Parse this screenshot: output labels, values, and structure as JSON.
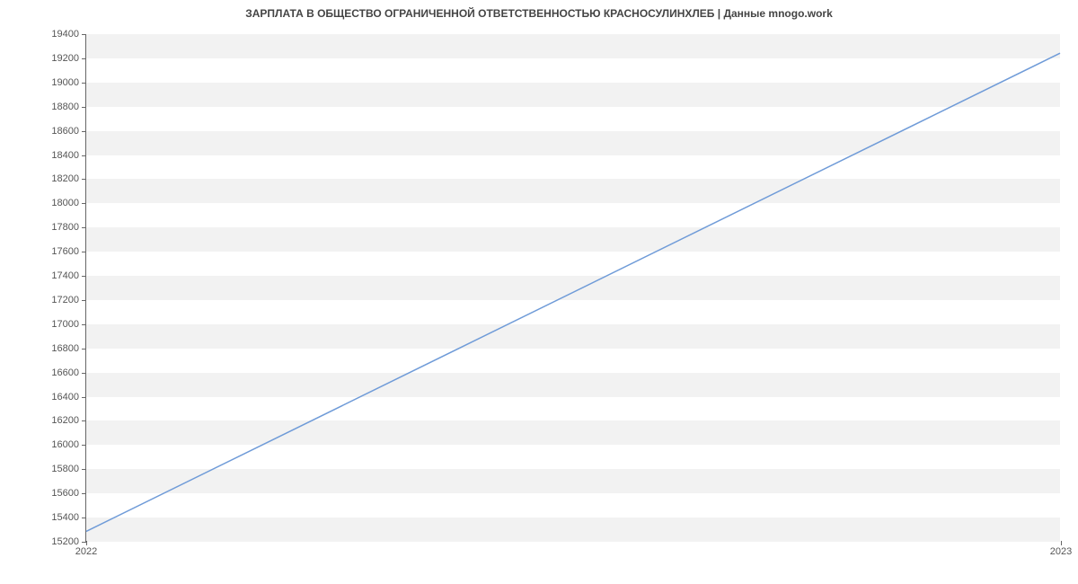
{
  "chart_data": {
    "type": "line",
    "title": "ЗАРПЛАТА В ОБЩЕСТВО ОГРАНИЧЕННОЙ ОТВЕТСТВЕННОСТЬЮ КРАСНОСУЛИНХЛЕБ | Данные mnogo.work",
    "xlabel": "",
    "ylabel": "",
    "x": [
      2022,
      2023
    ],
    "values": [
      15279,
      19242
    ],
    "x_ticks": [
      2022,
      2023
    ],
    "y_ticks": [
      15200,
      15400,
      15600,
      15800,
      16000,
      16200,
      16400,
      16600,
      16800,
      17000,
      17200,
      17400,
      17600,
      17800,
      18000,
      18200,
      18400,
      18600,
      18800,
      19000,
      19200,
      19400
    ],
    "xlim": [
      2022,
      2023
    ],
    "ylim": [
      15200,
      19400
    ],
    "line_color": "#6f9bd8",
    "band_color": "#f2f2f2"
  }
}
